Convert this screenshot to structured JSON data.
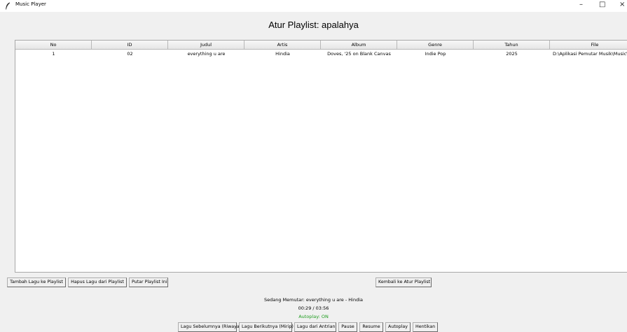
{
  "window": {
    "title": "Music Player",
    "minimize_glyph": "–",
    "maximize_glyph": "□",
    "close_glyph": "×"
  },
  "page": {
    "title": "Atur Playlist: apalahya"
  },
  "table": {
    "columns": [
      "No",
      "ID",
      "Judul",
      "Artis",
      "Album",
      "Genre",
      "Tahun",
      "File"
    ],
    "rows": [
      [
        "1",
        "02",
        "everything u are",
        "Hindia",
        "Doves, '25 on Blank Canvas",
        "Indie Pop",
        "2025",
        "D:\\Aplikasi Pemutar Musik\\Music\\"
      ]
    ]
  },
  "actions": {
    "add": "Tambah Lagu ke Playlist",
    "remove": "Hapus Lagu dari Playlist",
    "play_playlist": "Putar Playlist Ini",
    "back": "Kembali ke Atur Playlist"
  },
  "status": {
    "now_playing": "Sedang Memutar: everything u are - Hindia",
    "time": "00:29 / 03:56",
    "autoplay": "Autoplay: ON"
  },
  "controls": {
    "prev": "Lagu Sebelumnya (Riwayat)",
    "next": "Lagu Berikutnya (Mirip)",
    "queue": "Lagu dari Antrian",
    "pause": "Pause",
    "resume": "Resume",
    "autoplay": "Autoplay",
    "stop": "Hentikan"
  },
  "colors": {
    "autoplay_on": "#1e9c1e"
  },
  "icons": {
    "app": "feather-icon"
  }
}
